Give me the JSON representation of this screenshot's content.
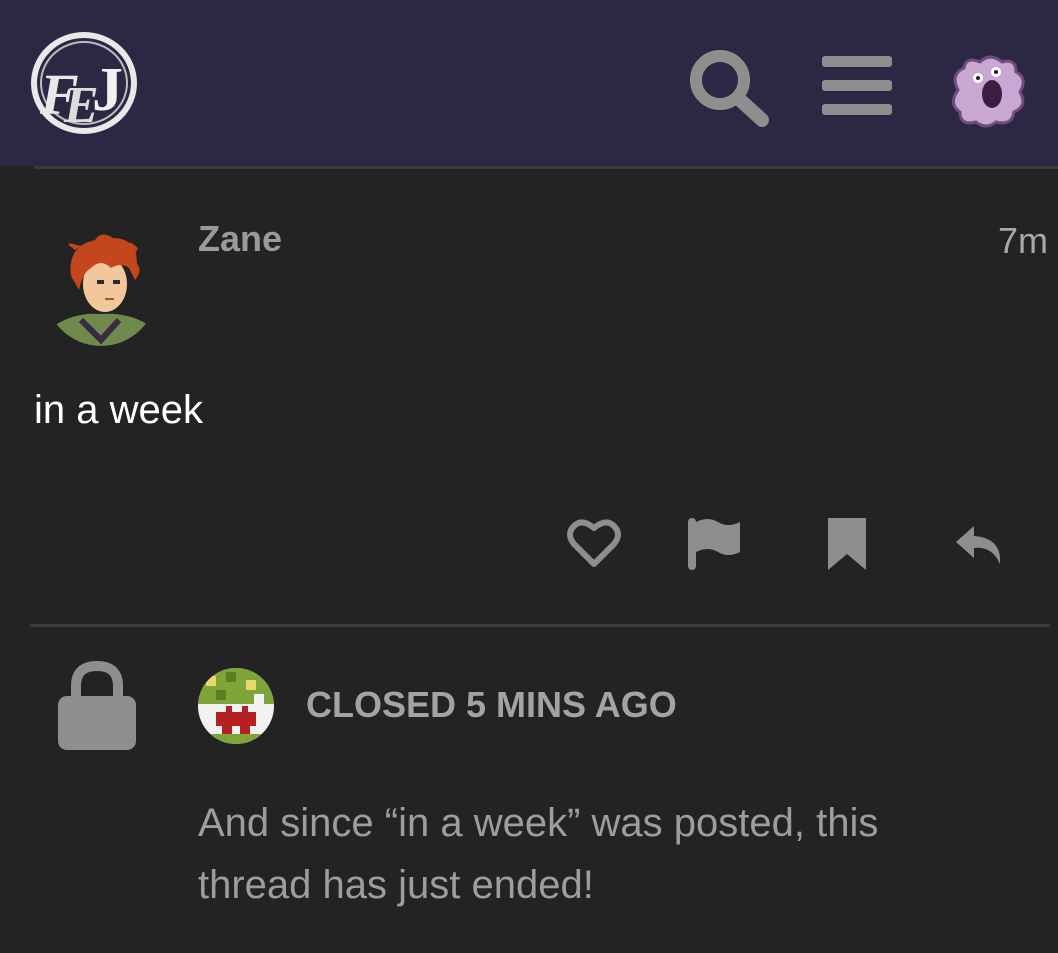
{
  "header": {
    "logo_text": "FEJ",
    "icons": {
      "search": "search-icon",
      "menu": "hamburger-menu-icon",
      "user": "user-avatar"
    }
  },
  "post": {
    "username": "Zane",
    "time": "7m",
    "body": "in a week",
    "actions": [
      "heart-icon",
      "flag-icon",
      "bookmark-icon",
      "reply-icon"
    ]
  },
  "closed_notice": {
    "label": "CLOSED 5 MINS AGO",
    "body": "And since “in a week” was posted, this thread has just ended!"
  },
  "colors": {
    "header_bg": "#2c2843",
    "page_bg": "#232323",
    "icon_gray": "#8e8e8e"
  }
}
